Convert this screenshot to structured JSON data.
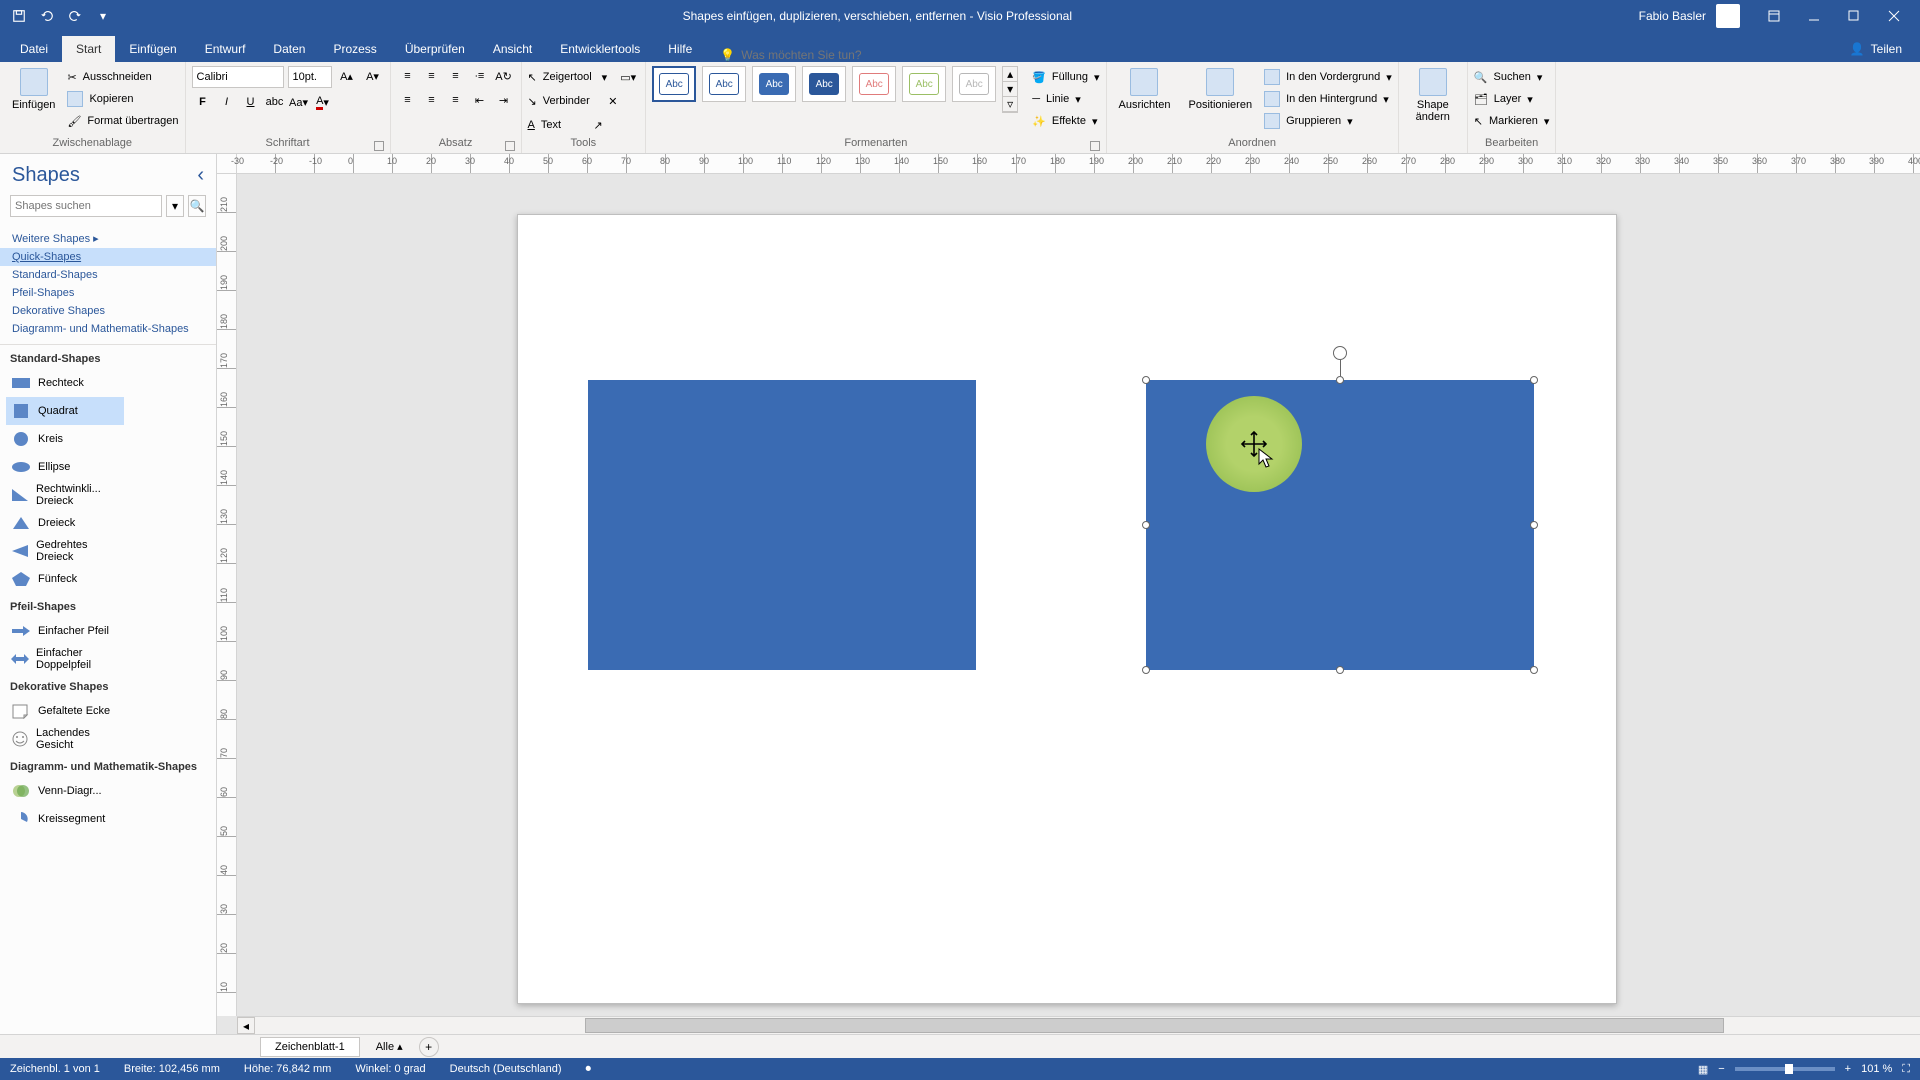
{
  "titlebar": {
    "doc_title": "Shapes einfügen, duplizieren, verschieben, entfernen  -  Visio Professional",
    "user_name": "Fabio Basler"
  },
  "tabs": {
    "file": "Datei",
    "items": [
      "Start",
      "Einfügen",
      "Entwurf",
      "Daten",
      "Prozess",
      "Überprüfen",
      "Ansicht",
      "Entwicklertools",
      "Hilfe"
    ],
    "active_index": 0,
    "tell_me_placeholder": "Was möchten Sie tun?",
    "share": "Teilen"
  },
  "ribbon": {
    "clipboard": {
      "paste": "Einfügen",
      "cut": "Ausschneiden",
      "copy": "Kopieren",
      "format_painter": "Format übertragen",
      "label": "Zwischenablage"
    },
    "font": {
      "name": "Calibri",
      "size": "10pt.",
      "label": "Schriftart"
    },
    "paragraph": {
      "label": "Absatz"
    },
    "tools": {
      "pointer": "Zeigertool",
      "connector": "Verbinder",
      "text": "Text",
      "fill_style": "A",
      "label": "Tools"
    },
    "shape_styles": {
      "abc": "Abc",
      "swatches": [
        {
          "bg": "#fff",
          "fg": "#2b579a",
          "border": "#2b579a",
          "sel": true
        },
        {
          "bg": "#fff",
          "fg": "#2b579a",
          "border": "#2b579a"
        },
        {
          "bg": "#3a6bb3",
          "fg": "#fff",
          "border": "#3a6bb3"
        },
        {
          "bg": "#2b579a",
          "fg": "#fff",
          "border": "#2b579a"
        },
        {
          "bg": "#fff",
          "fg": "#e07b7b",
          "border": "#e07b7b"
        },
        {
          "bg": "#fff",
          "fg": "#9bbf65",
          "border": "#9bbf65"
        },
        {
          "bg": "#fff",
          "fg": "#b7b7b7",
          "border": "#b7b7b7"
        }
      ],
      "fill": "Füllung",
      "line": "Linie",
      "effects": "Effekte",
      "label": "Formenarten"
    },
    "arrange": {
      "align": "Ausrichten",
      "position": "Positionieren",
      "bring_front": "In den Vordergrund",
      "send_back": "In den Hintergrund",
      "group": "Gruppieren",
      "label": "Anordnen"
    },
    "change_shape": {
      "label_btn": "Shape ändern"
    },
    "editing": {
      "find": "Suchen",
      "layer": "Layer",
      "select": "Markieren",
      "label": "Bearbeiten"
    }
  },
  "shapes_pane": {
    "title": "Shapes",
    "search_placeholder": "Shapes suchen",
    "more_shapes": "Weitere Shapes",
    "stencils": [
      "Quick-Shapes",
      "Standard-Shapes",
      "Pfeil-Shapes",
      "Dekorative Shapes",
      "Diagramm- und Mathematik-Shapes"
    ],
    "active_stencil_index": 0,
    "categories": [
      {
        "head": "Standard-Shapes",
        "shapes": [
          {
            "label": "Rechteck",
            "svg": "rect"
          },
          {
            "label": "Quadrat",
            "svg": "square",
            "sel": true
          },
          {
            "label": "Kreis",
            "svg": "circle"
          },
          {
            "label": "Ellipse",
            "svg": "ellipse"
          },
          {
            "label": "Rechtwinkli... Dreieck",
            "svg": "rtri"
          },
          {
            "label": "Dreieck",
            "svg": "tri"
          },
          {
            "label": "Gedrehtes Dreieck",
            "svg": "ltri"
          },
          {
            "label": "Fünfeck",
            "svg": "pent"
          }
        ]
      },
      {
        "head": "Pfeil-Shapes",
        "shapes": [
          {
            "label": "Einfacher Pfeil",
            "svg": "arrow"
          },
          {
            "label": "Einfacher Doppelpfeil",
            "svg": "darrow"
          }
        ]
      },
      {
        "head": "Dekorative Shapes",
        "shapes": [
          {
            "label": "Gefaltete Ecke",
            "svg": "fold"
          },
          {
            "label": "Lachendes Gesicht",
            "svg": "smile"
          }
        ]
      },
      {
        "head": "Diagramm- und Mathematik-Shapes",
        "shapes": [
          {
            "label": "Venn-Diagr...",
            "svg": "venn"
          },
          {
            "label": "Kreissegment",
            "svg": "pie"
          }
        ]
      }
    ]
  },
  "ruler": {
    "h_start": -30,
    "h_step": 10,
    "h_count": 48,
    "v_start": 210,
    "v_step": -10,
    "v_count": 22
  },
  "sheets": {
    "active": "Zeichenblatt-1",
    "all": "Alle"
  },
  "statusbar": {
    "page_info": "Zeichenbl. 1 von 1",
    "width": "Breite: 102,456 mm",
    "height": "Höhe: 76,842 mm",
    "angle": "Winkel: 0 grad",
    "lang": "Deutsch (Deutschland)",
    "zoom": "101 %"
  },
  "colors": {
    "accent": "#2b579a",
    "shape_fill": "#3a6bb3"
  }
}
